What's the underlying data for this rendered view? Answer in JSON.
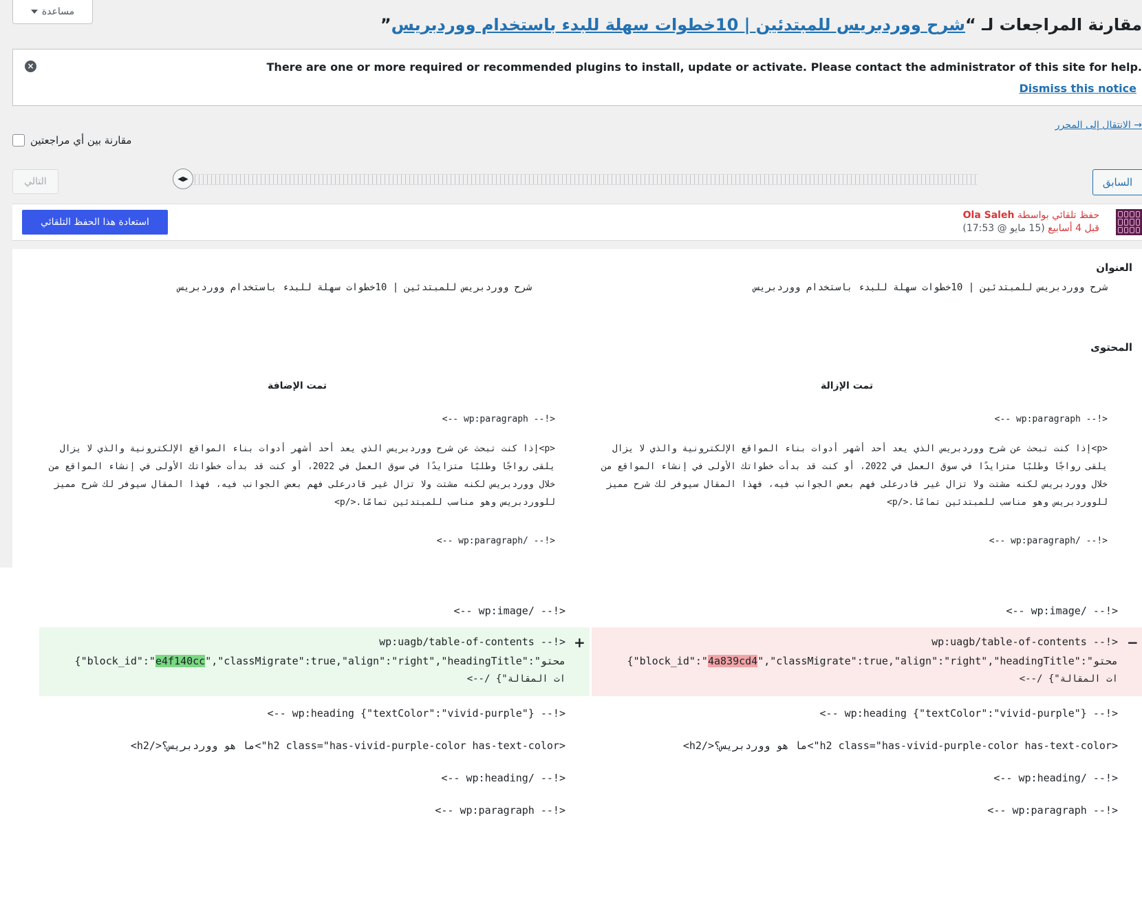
{
  "help": {
    "label": "مساعدة"
  },
  "title": {
    "prefix": "مقارنة المراجعات لـ “",
    "link": "شرح ووردبريس للمبتدئين | 10خطوات سهلة للبدء باستخدام ووردبريس",
    "suffix": "”"
  },
  "notice": {
    "text": "There are one or more required or recommended plugins to install, update or activate. Please contact the administrator of this site for help.",
    "dismiss": "Dismiss this notice"
  },
  "editor_link": "→ الانتقال إلى المحرر",
  "compare_any": "مقارنة بين أي مراجعتين",
  "nav": {
    "next": "التالي",
    "prev": "السابق"
  },
  "revision": {
    "byline_prefix": "حفظ تلقائي بواسطة",
    "author": "Ola Saleh",
    "time_ago": "قبل 4 أسابيع",
    "date": "(15 مايو @ 17:53)",
    "restore": "استعادة هذا الحفظ التلقائي"
  },
  "diff": {
    "title_heading": "العنوان",
    "title_left": "شرح ووردبريس للمبتدئين | 10خطوات سهلة للبدء باستخدام ووردبريس",
    "title_right": "شرح ووردبريس للمبتدئين | 10خطوات سهلة للبدء باستخدام ووردبريس",
    "content_heading": "المحتوى",
    "removed_label": "تمت الإزالة",
    "added_label": "تمت الإضافة",
    "wp_paragraph_open": "<!-- wp:paragraph -->",
    "paragraph_text": "<p>إذا كنت تبحث عن شرح ووردبريس الذي يعد أحد أشهر أدوات بناء المواقع الإلكترونية والذي لا يزال يلقى رواجًا وطلبًا متزايدًا في سوق العمل في 2022، أو كنت قد بدأت خطواتك الأولى في إنشاء المواقع من خلال ووردبريس لكنه مشتت ولا تزال غير قادرعلى فهم بعض الجوانب فيه، فهذا المقال سيوفر لك شرح مميز للووردبريس وهو مناسب للمبتدئين تمامًا.</p>",
    "wp_paragraph_close": "<!-- /wp:paragraph -->",
    "wp_image_close": "<!-- /wp:image -->",
    "toc_open": "<!-- wp:uagb/table-of-contents",
    "toc_attrs_pre": "{\"block_id\":\"",
    "toc_id_removed": "4a839cd4",
    "toc_id_added": "e4f140cc",
    "toc_attrs_post": "\",\"classMigrate\":true,\"align\":\"right\",\"headingTitle\":\"محتو",
    "toc_tail": "ات المقالة\"} /-->",
    "sign_removed": "−",
    "sign_added": "+",
    "heading_open": "<!-- wp:heading {\"textColor\":\"vivid-purple\"} -->",
    "h2_line": "<h2 class=\"has-vivid-purple-color has-text-color\">ما هو ووردبريس؟</h2>",
    "heading_close": "<!-- /wp:heading -->",
    "paragraph_open2": "<!-- wp:paragraph -->"
  },
  "colors": {
    "accent": "#2271b1",
    "primary_button": "#3858e9",
    "removed_bg": "#fce9e9",
    "added_bg": "#ebf8ec",
    "removed_hl": "#f1a3a6",
    "added_hl": "#7ad782"
  }
}
